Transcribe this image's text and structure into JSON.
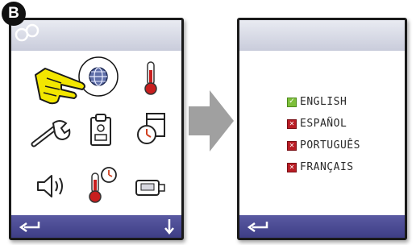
{
  "step_badge": "B",
  "colors": {
    "bar_top": "#d4d6e2",
    "bar_bottom": "#3e3e85",
    "selected": "#7dbf3a",
    "unselected": "#b91c24",
    "arrow": "#a0a0a0",
    "hand": "#f2e600"
  },
  "screen_left": {
    "status_icon": "accessory-icon",
    "highlighted_icon": "globe-icon",
    "icons": [
      "globe-icon",
      "thermometer-icon",
      "wrench-icon",
      "clipboard-icon",
      "clock-calendar-icon",
      "speaker-icon",
      "thermometer-clock-icon",
      "usb-icon"
    ],
    "pointer": "pointing-hand-icon",
    "back_button": "back-arrow-icon",
    "down_button": "down-arrow-icon"
  },
  "transition": "right-arrow-icon",
  "screen_right": {
    "languages": [
      {
        "label": "ENGLISH",
        "selected": true
      },
      {
        "label": "ESPAÑOL",
        "selected": false
      },
      {
        "label": "PORTUGUÊS",
        "selected": false
      },
      {
        "label": "FRANÇAIS",
        "selected": false
      }
    ],
    "back_button": "back-arrow-icon"
  }
}
